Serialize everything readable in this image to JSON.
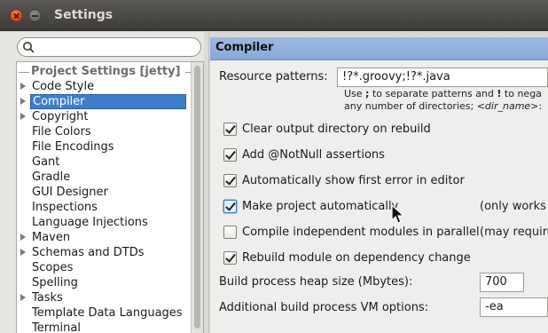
{
  "window": {
    "title": "Settings"
  },
  "search": {
    "placeholder": ""
  },
  "tree": {
    "group_label": "Project Settings [jetty]",
    "items": [
      {
        "label": "Code Style",
        "expandable": true
      },
      {
        "label": "Compiler",
        "expandable": true,
        "selected": true
      },
      {
        "label": "Copyright",
        "expandable": true
      },
      {
        "label": "File Colors",
        "expandable": false
      },
      {
        "label": "File Encodings",
        "expandable": false
      },
      {
        "label": "Gant",
        "expandable": false
      },
      {
        "label": "Gradle",
        "expandable": false
      },
      {
        "label": "GUI Designer",
        "expandable": false
      },
      {
        "label": "Inspections",
        "expandable": false
      },
      {
        "label": "Language Injections",
        "expandable": false
      },
      {
        "label": "Maven",
        "expandable": true
      },
      {
        "label": "Schemas and DTDs",
        "expandable": true
      },
      {
        "label": "Scopes",
        "expandable": false
      },
      {
        "label": "Spelling",
        "expandable": false
      },
      {
        "label": "Tasks",
        "expandable": true
      },
      {
        "label": "Template Data Languages",
        "expandable": false
      },
      {
        "label": "Terminal",
        "expandable": false
      }
    ]
  },
  "compiler": {
    "header": "Compiler",
    "resource_patterns_label": "Resource patterns:",
    "resource_patterns_value": "!?*.groovy;!?*.java",
    "hint_line1_a": "Use ",
    "hint_line1_b": ";",
    "hint_line1_c": " to separate patterns and ",
    "hint_line1_d": "!",
    "hint_line1_e": " to nega",
    "hint_line2_a": "any number of directories; ",
    "hint_line2_b": "<dir_name>",
    "hint_line2_c": ":",
    "options": [
      {
        "label": "Clear output directory on rebuild",
        "checked": true,
        "note": ""
      },
      {
        "label": "Add @NotNull assertions",
        "checked": true,
        "note": ""
      },
      {
        "label": "Automatically show first error in editor",
        "checked": true,
        "note": ""
      },
      {
        "label": "Make project automatically",
        "checked": true,
        "focused": true,
        "note": "(only works w"
      },
      {
        "label": "Compile independent modules in parallel",
        "checked": false,
        "note": "(may require"
      },
      {
        "label": "Rebuild module on dependency change",
        "checked": true,
        "note": ""
      }
    ],
    "heap_label": "Build process heap size (Mbytes):",
    "heap_value": "700",
    "vm_label": "Additional build process VM options:",
    "vm_value": "-ea"
  }
}
